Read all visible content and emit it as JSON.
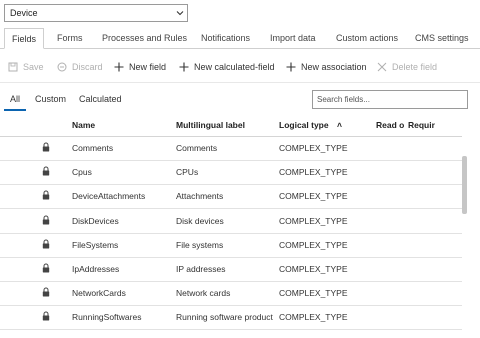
{
  "entity_select": {
    "value": "Device"
  },
  "tabs": [
    {
      "label": "Fields"
    },
    {
      "label": "Forms"
    },
    {
      "label": "Processes and Rules"
    },
    {
      "label": "Notifications"
    },
    {
      "label": "Import data"
    },
    {
      "label": "Custom actions"
    },
    {
      "label": "CMS settings"
    }
  ],
  "toolbar": {
    "save": "Save",
    "discard": "Discard",
    "new_field": "New field",
    "new_calculated_field": "New calculated-field",
    "new_association": "New association",
    "delete_field": "Delete field"
  },
  "filter_tabs": [
    {
      "label": "All"
    },
    {
      "label": "Custom"
    },
    {
      "label": "Calculated"
    }
  ],
  "search": {
    "placeholder": "Search fields..."
  },
  "table": {
    "columns": [
      "Name",
      "Multilingual label",
      "Logical type",
      "Read o",
      "Requir"
    ],
    "sort_indicator": "˄",
    "rows": [
      {
        "name": "Comments",
        "label": "Comments",
        "type": "COMPLEX_TYPE"
      },
      {
        "name": "Cpus",
        "label": "CPUs",
        "type": "COMPLEX_TYPE"
      },
      {
        "name": "DeviceAttachments",
        "label": "Attachments",
        "type": "COMPLEX_TYPE"
      },
      {
        "name": "DiskDevices",
        "label": "Disk devices",
        "type": "COMPLEX_TYPE"
      },
      {
        "name": "FileSystems",
        "label": "File systems",
        "type": "COMPLEX_TYPE"
      },
      {
        "name": "IpAddresses",
        "label": "IP addresses",
        "type": "COMPLEX_TYPE"
      },
      {
        "name": "NetworkCards",
        "label": "Network cards",
        "type": "COMPLEX_TYPE"
      },
      {
        "name": "RunningSoftwares",
        "label": "Running software product",
        "type": "COMPLEX_TYPE"
      }
    ]
  },
  "colors": {
    "accent": "#0b64b0",
    "disabled": "#b0b0b0"
  }
}
